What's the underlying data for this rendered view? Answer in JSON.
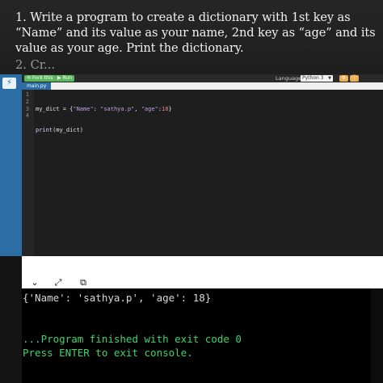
{
  "question": {
    "text": "1. Write a program to create a dictionary with 1st key as “Name” and its value as your name, 2nd key as “age” and its value as your age. Print the dictionary.",
    "cut_off_next": "2. Cr... "
  },
  "rail": {
    "run_icon": "lightning-icon"
  },
  "toolbar": {
    "fork_label": "Fork this",
    "run_label": "Run",
    "language_label": "Language",
    "language_value": "Python 3",
    "icon_a": "gear-icon",
    "icon_b": "info-icon",
    "accent": "#5cb85c"
  },
  "file_tab": "main.py",
  "editor": {
    "line_numbers": [
      "1",
      "2",
      "3",
      "4"
    ],
    "line1": {
      "name": "my_dict",
      "eq": " = {",
      "k1": "\"Name\"",
      "c1": ": ",
      "v1": "\"sathya.p\"",
      "c2": ", ",
      "k2": "\"age\"",
      "c3": ":",
      "v2": "18",
      "end": "}"
    },
    "line2": {
      "fn": "print",
      "arg": "(my_dict)"
    }
  },
  "output_header": {
    "collapse_icon": "chevron-down-icon",
    "expand_icon": "expand-arrows-icon",
    "copy_icon": "copy-icon"
  },
  "console": {
    "result": "{'Name': 'sathya.p', 'age': 18}",
    "finish": "...Program finished with exit code 0",
    "prompt": "Press ENTER to exit console."
  }
}
